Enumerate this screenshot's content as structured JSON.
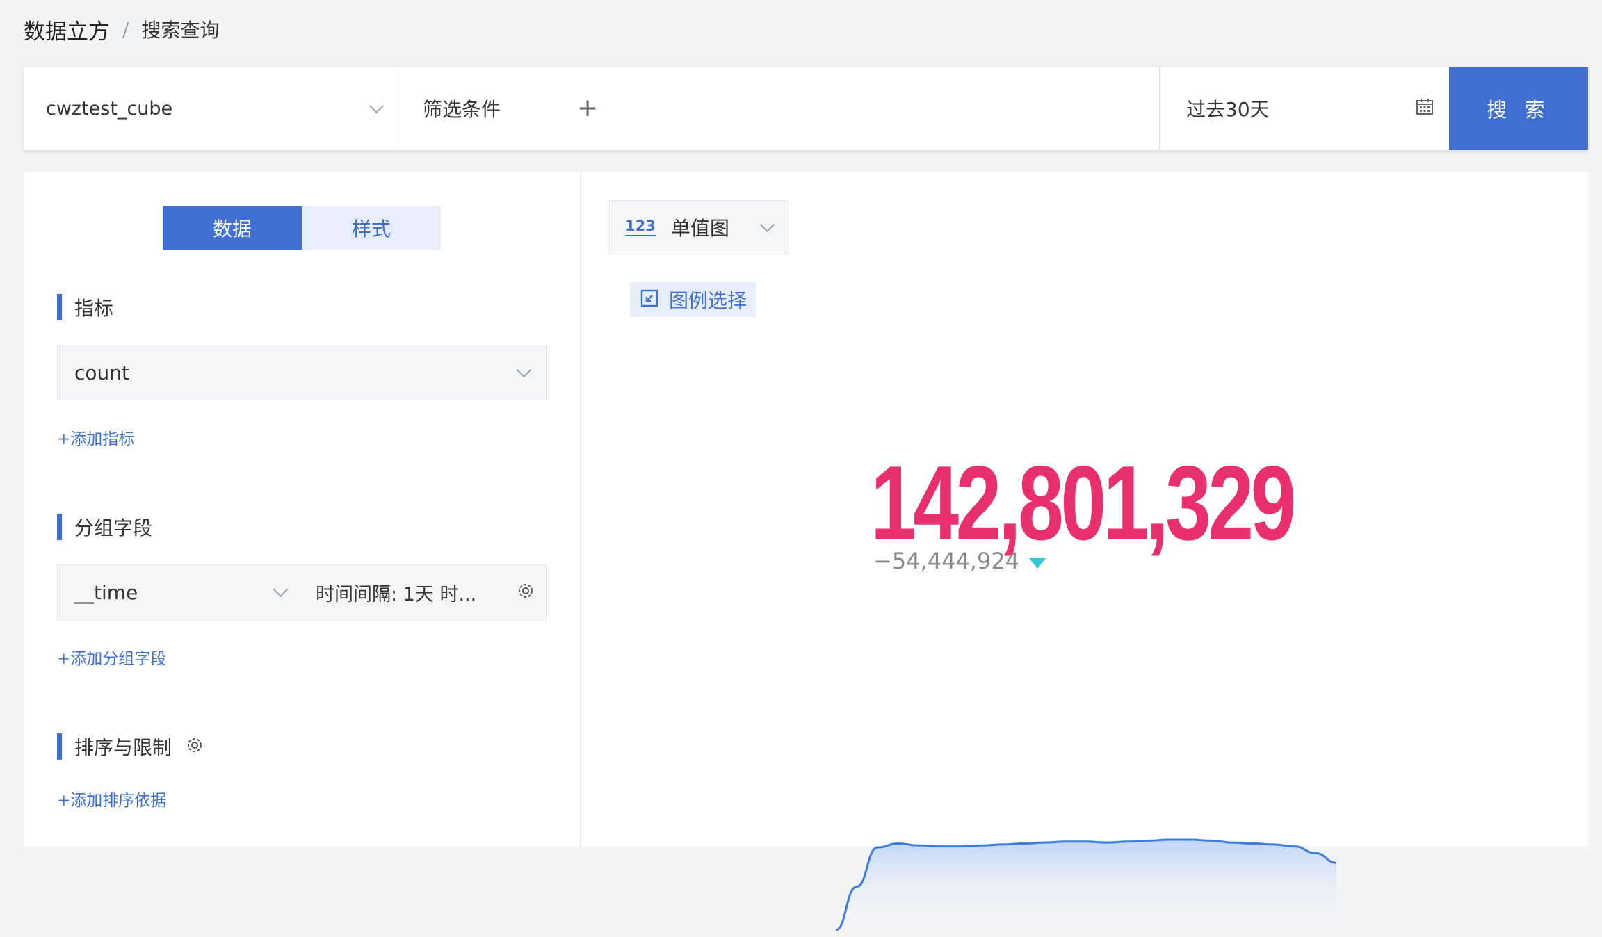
{
  "breadcrumb": {
    "root": "数据立方",
    "separator": "/",
    "current": "搜索查询"
  },
  "toolbar": {
    "cube": "cwztest_cube",
    "filter_label": "筛选条件",
    "filter_add": "+",
    "date_range": "过去30天",
    "search_label": "搜 索"
  },
  "tabs": {
    "data": "数据",
    "style": "样式",
    "active": "数据"
  },
  "metrics": {
    "title": "指标",
    "value": "count",
    "add": "+添加指标"
  },
  "group": {
    "title": "分组字段",
    "field": "__time",
    "interval": "时间间隔: 1天 时...",
    "add": "+添加分组字段"
  },
  "sort": {
    "title": "排序与限制",
    "add": "+添加排序依据"
  },
  "chart": {
    "type_icon": "123",
    "type_label": "单值图",
    "legend_label": "图例选择",
    "value_text": "142,801,329",
    "delta_text": "−54,444,924",
    "delta_direction": "down",
    "colors": {
      "value": "#e8306e",
      "delta_arrow": "#33c6d6",
      "line": "#3a7cdf",
      "accent": "#3f6fd1"
    }
  },
  "chart_data": {
    "type": "area",
    "values": [
      0,
      45,
      86,
      90,
      88,
      87,
      87,
      88,
      89,
      90,
      91,
      92,
      92,
      91,
      92,
      93,
      94,
      94,
      93,
      91,
      90,
      89,
      87,
      80,
      70
    ]
  }
}
